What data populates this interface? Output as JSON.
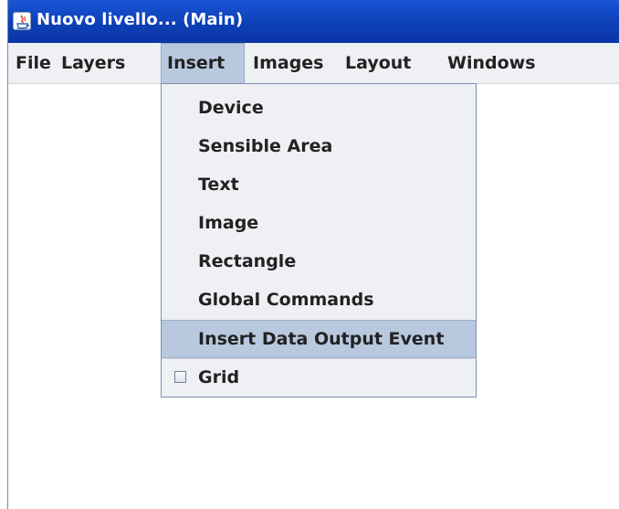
{
  "window": {
    "title": "Nuovo livello... (Main)"
  },
  "menubar": {
    "items": [
      {
        "label": "File"
      },
      {
        "label": "Layers"
      },
      {
        "label": "Insert"
      },
      {
        "label": "Images"
      },
      {
        "label": "Layout"
      },
      {
        "label": "Windows"
      }
    ],
    "active": "Insert"
  },
  "insert_menu": {
    "items": [
      {
        "label": "Device"
      },
      {
        "label": "Sensible Area"
      },
      {
        "label": "Text"
      },
      {
        "label": "Image"
      },
      {
        "label": "Rectangle"
      },
      {
        "label": "Global Commands"
      },
      {
        "label": "Insert Data Output Event"
      }
    ],
    "highlighted": "Insert Data Output Event",
    "grid": {
      "label": "Grid",
      "checked": false
    }
  },
  "icons": {
    "app": "java-app-icon",
    "grid_check": "checkbox-icon"
  },
  "colors": {
    "titlebar": "#0c3fb6",
    "menubar": "#eef0f4",
    "highlight": "#b8c9df",
    "dropdown_border": "#7d8fb0"
  }
}
